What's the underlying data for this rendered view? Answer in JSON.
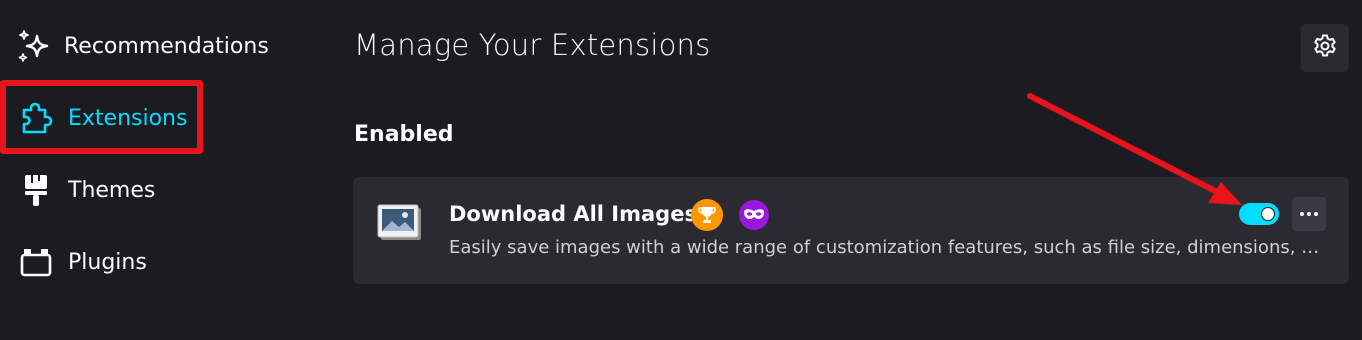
{
  "sidebar": {
    "items": [
      {
        "label": "Recommendations",
        "icon": "sparkle-icon",
        "active": false
      },
      {
        "label": "Extensions",
        "icon": "puzzle-icon",
        "active": true
      },
      {
        "label": "Themes",
        "icon": "paintbrush-icon",
        "active": false
      },
      {
        "label": "Plugins",
        "icon": "plugin-icon",
        "active": false
      }
    ]
  },
  "main": {
    "title": "Manage Your Extensions",
    "settings_icon": "gear-icon",
    "section_heading": "Enabled",
    "extensions": [
      {
        "name": "Download All Images",
        "description": "Easily save images with a wide range of customization features, such as file size, dimensions, …",
        "enabled": true,
        "badges": [
          "recommended-trophy-icon",
          "private-browsing-icon"
        ]
      }
    ]
  },
  "colors": {
    "accent": "#00ddff",
    "background": "#1c1b22",
    "card": "#2b2a33",
    "annotation_red": "#e8141b",
    "recommended_badge": "#ff9800",
    "private_badge": "#9a17db"
  }
}
